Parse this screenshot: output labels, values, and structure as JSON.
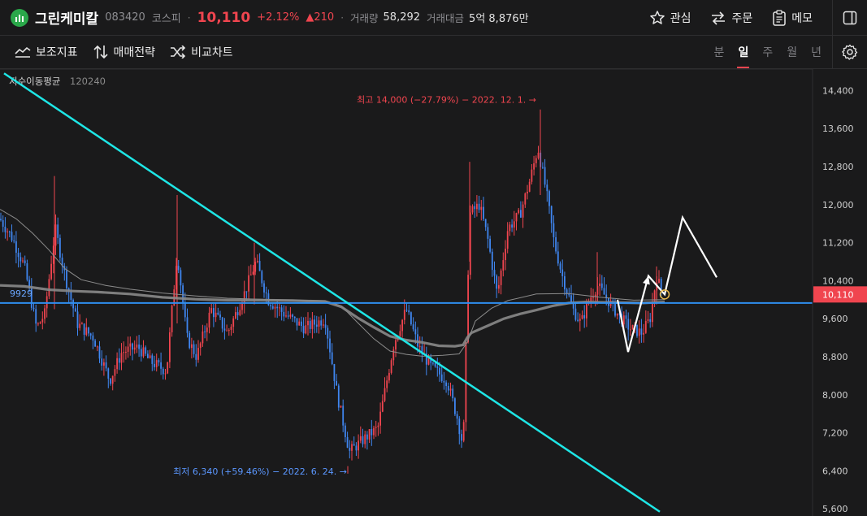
{
  "header": {
    "stock_name": "그린케미칼",
    "code": "083420",
    "market": "코스피",
    "separator": "·",
    "price": "10,110",
    "change_pct": "+2.12%",
    "change_abs": "▲210",
    "volume_label": "거래량",
    "volume": "58,292",
    "amount_label": "거래대금",
    "amount": "5억 8,876만",
    "watch_label": "관심",
    "order_label": "주문",
    "memo_label": "메모"
  },
  "toolbar": {
    "indicator_label": "보조지표",
    "strategy_label": "매매전략",
    "compare_label": "비교차트",
    "periods": [
      "분",
      "일",
      "주",
      "월",
      "년"
    ],
    "active_period": "일"
  },
  "colors": {
    "up": "#f0454f",
    "down": "#3f86f0",
    "trendline": "#1ee6e6",
    "hline": "#2f8ff0",
    "ma120": "#8a8a8a",
    "ma240": "#8c8c8c"
  },
  "chart_data": {
    "type": "candlestick",
    "indicator_label": "지수이동평균",
    "ma_periods": [
      "120",
      "240"
    ],
    "y_ticks": [
      "14,400",
      "13,600",
      "12,800",
      "12,000",
      "11,200",
      "10,400",
      "9,600",
      "8,800",
      "8,000",
      "7,200",
      "6,400",
      "5,600"
    ],
    "y_tick_values": [
      14400,
      13600,
      12800,
      12000,
      11200,
      10400,
      9600,
      8800,
      8000,
      7200,
      6400,
      5600
    ],
    "ylim": [
      5450,
      14850
    ],
    "current_price_label": "10,110",
    "current_price": 10110,
    "hline_label": "9929",
    "hline_value": 9929,
    "high_annotation": "최고 14,000 (−27.79%) − 2022. 12. 1. →",
    "high_value": 14000,
    "low_annotation": "최저 6,340 (+59.46%) − 2022. 6. 24. →",
    "low_value": 6340,
    "ma120_path": [
      [
        0,
        10300
      ],
      [
        30,
        10280
      ],
      [
        60,
        10210
      ],
      [
        90,
        10180
      ],
      [
        120,
        10160
      ],
      [
        160,
        10120
      ],
      [
        200,
        10050
      ],
      [
        240,
        10010
      ],
      [
        280,
        9990
      ],
      [
        320,
        9990
      ],
      [
        360,
        9980
      ],
      [
        400,
        9960
      ],
      [
        420,
        9850
      ],
      [
        440,
        9620
      ],
      [
        460,
        9420
      ],
      [
        480,
        9230
      ],
      [
        500,
        9150
      ],
      [
        520,
        9100
      ],
      [
        540,
        9030
      ],
      [
        560,
        9020
      ],
      [
        570,
        9050
      ],
      [
        575,
        9200
      ],
      [
        580,
        9300
      ],
      [
        600,
        9450
      ],
      [
        620,
        9600
      ],
      [
        640,
        9700
      ],
      [
        660,
        9780
      ],
      [
        680,
        9870
      ],
      [
        700,
        9930
      ],
      [
        720,
        9950
      ],
      [
        760,
        9940
      ],
      [
        790,
        9930
      ],
      [
        818,
        9950
      ]
    ],
    "ma240_path": [
      [
        0,
        11900
      ],
      [
        20,
        11700
      ],
      [
        40,
        11400
      ],
      [
        60,
        11050
      ],
      [
        80,
        10650
      ],
      [
        100,
        10420
      ],
      [
        130,
        10300
      ],
      [
        160,
        10220
      ],
      [
        200,
        10140
      ],
      [
        240,
        10080
      ],
      [
        280,
        10030
      ],
      [
        320,
        10010
      ],
      [
        360,
        9990
      ],
      [
        400,
        9980
      ],
      [
        420,
        9870
      ],
      [
        440,
        9520
      ],
      [
        460,
        9180
      ],
      [
        480,
        8920
      ],
      [
        500,
        8850
      ],
      [
        520,
        8810
      ],
      [
        545,
        8830
      ],
      [
        565,
        8860
      ],
      [
        575,
        9100
      ],
      [
        585,
        9550
      ],
      [
        605,
        9820
      ],
      [
        625,
        9980
      ],
      [
        660,
        10120
      ],
      [
        700,
        10130
      ],
      [
        740,
        10050
      ],
      [
        780,
        9990
      ],
      [
        818,
        10000
      ]
    ],
    "trendline": [
      [
        5,
        14760
      ],
      [
        812,
        5540
      ]
    ],
    "scenario_path": [
      [
        760,
        10000
      ],
      [
        773,
        8900
      ],
      [
        798,
        10500
      ],
      [
        818,
        10110
      ],
      [
        840,
        11730
      ],
      [
        882,
        10470
      ]
    ]
  }
}
